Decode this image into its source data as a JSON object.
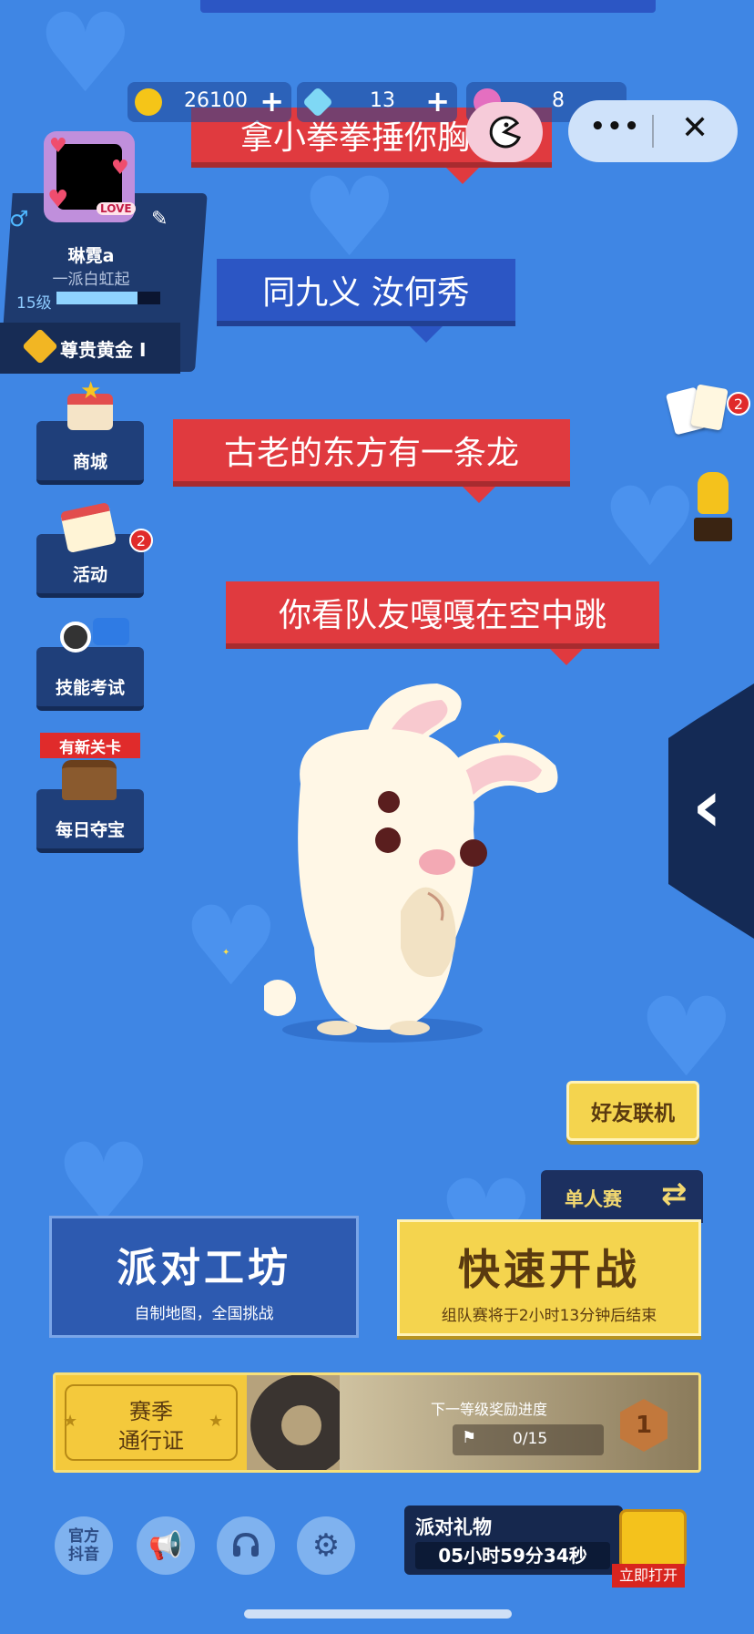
{
  "resources": {
    "coins": "26100",
    "diamonds": "13",
    "tickets": "8"
  },
  "window_controls": {
    "more_label": "•••",
    "close_label": "✕"
  },
  "profile": {
    "name": "琳霓a",
    "signature": "一派白虹起",
    "level": "15级",
    "level_progress": 0.78,
    "rank": "尊贵黄金 I",
    "gender_symbol": "♂",
    "frame_text": "LOVE"
  },
  "bubbles": [
    {
      "text": "拿小拳拳捶你胸口"
    },
    {
      "text": "同九义 汝何秀"
    },
    {
      "text": "古老的东方有一条龙"
    },
    {
      "text": "你看队友嘎嘎在空中跳"
    }
  ],
  "side_menu": {
    "shop": "商城",
    "activity": "活动",
    "activity_badge": "2",
    "skill_test": "技能考试",
    "new_level_tag": "有新关卡",
    "daily_treasure": "每日夺宝"
  },
  "right_side": {
    "cards_badge": "2",
    "expand_arrow": "‹"
  },
  "buttons": {
    "friends_online": "好友联机",
    "single_match": "单人赛",
    "workshop_title": "派对工坊",
    "workshop_sub": "自制地图，全国挑战",
    "quick_battle_title": "快速开战",
    "quick_battle_sub": "组队赛将于2小时13分钟后结束"
  },
  "season_pass": {
    "title_line1": "赛季",
    "title_line2": "通行证",
    "next_reward_label": "下一等级奖励进度",
    "progress": "0/15",
    "level": "1"
  },
  "bottom_bar": {
    "official_douyin_line1": "官方",
    "official_douyin_line2": "抖音",
    "party_gift_title": "派对礼物",
    "party_gift_timer": "05小时59分34秒",
    "open_now": "立即打开"
  },
  "colors": {
    "background": "#3f86e4",
    "bubble_red": "#e03a3f",
    "bubble_blue": "#2c56c4",
    "yellow_button": "#f4d44e",
    "dark_panel": "#1f3f7a"
  }
}
